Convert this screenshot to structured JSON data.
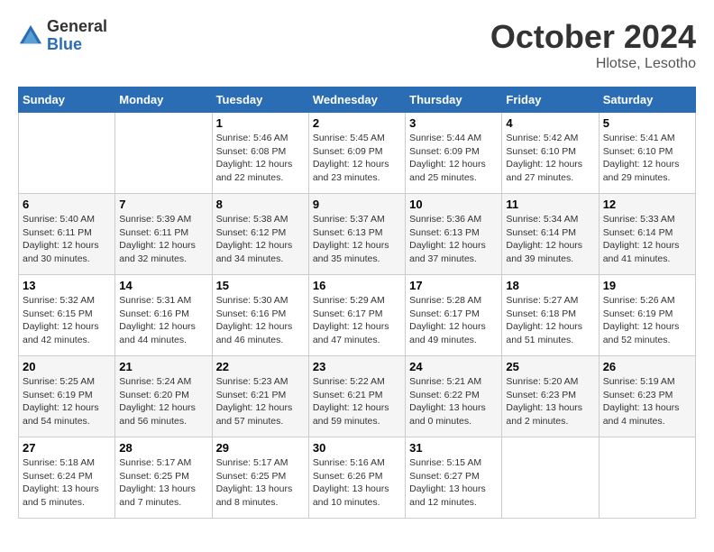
{
  "logo": {
    "general": "General",
    "blue": "Blue"
  },
  "title": "October 2024",
  "location": "Hlotse, Lesotho",
  "days_header": [
    "Sunday",
    "Monday",
    "Tuesday",
    "Wednesday",
    "Thursday",
    "Friday",
    "Saturday"
  ],
  "weeks": [
    [
      {
        "day": "",
        "sunrise": "",
        "sunset": "",
        "daylight": ""
      },
      {
        "day": "",
        "sunrise": "",
        "sunset": "",
        "daylight": ""
      },
      {
        "day": "1",
        "sunrise": "Sunrise: 5:46 AM",
        "sunset": "Sunset: 6:08 PM",
        "daylight": "Daylight: 12 hours and 22 minutes."
      },
      {
        "day": "2",
        "sunrise": "Sunrise: 5:45 AM",
        "sunset": "Sunset: 6:09 PM",
        "daylight": "Daylight: 12 hours and 23 minutes."
      },
      {
        "day": "3",
        "sunrise": "Sunrise: 5:44 AM",
        "sunset": "Sunset: 6:09 PM",
        "daylight": "Daylight: 12 hours and 25 minutes."
      },
      {
        "day": "4",
        "sunrise": "Sunrise: 5:42 AM",
        "sunset": "Sunset: 6:10 PM",
        "daylight": "Daylight: 12 hours and 27 minutes."
      },
      {
        "day": "5",
        "sunrise": "Sunrise: 5:41 AM",
        "sunset": "Sunset: 6:10 PM",
        "daylight": "Daylight: 12 hours and 29 minutes."
      }
    ],
    [
      {
        "day": "6",
        "sunrise": "Sunrise: 5:40 AM",
        "sunset": "Sunset: 6:11 PM",
        "daylight": "Daylight: 12 hours and 30 minutes."
      },
      {
        "day": "7",
        "sunrise": "Sunrise: 5:39 AM",
        "sunset": "Sunset: 6:11 PM",
        "daylight": "Daylight: 12 hours and 32 minutes."
      },
      {
        "day": "8",
        "sunrise": "Sunrise: 5:38 AM",
        "sunset": "Sunset: 6:12 PM",
        "daylight": "Daylight: 12 hours and 34 minutes."
      },
      {
        "day": "9",
        "sunrise": "Sunrise: 5:37 AM",
        "sunset": "Sunset: 6:13 PM",
        "daylight": "Daylight: 12 hours and 35 minutes."
      },
      {
        "day": "10",
        "sunrise": "Sunrise: 5:36 AM",
        "sunset": "Sunset: 6:13 PM",
        "daylight": "Daylight: 12 hours and 37 minutes."
      },
      {
        "day": "11",
        "sunrise": "Sunrise: 5:34 AM",
        "sunset": "Sunset: 6:14 PM",
        "daylight": "Daylight: 12 hours and 39 minutes."
      },
      {
        "day": "12",
        "sunrise": "Sunrise: 5:33 AM",
        "sunset": "Sunset: 6:14 PM",
        "daylight": "Daylight: 12 hours and 41 minutes."
      }
    ],
    [
      {
        "day": "13",
        "sunrise": "Sunrise: 5:32 AM",
        "sunset": "Sunset: 6:15 PM",
        "daylight": "Daylight: 12 hours and 42 minutes."
      },
      {
        "day": "14",
        "sunrise": "Sunrise: 5:31 AM",
        "sunset": "Sunset: 6:16 PM",
        "daylight": "Daylight: 12 hours and 44 minutes."
      },
      {
        "day": "15",
        "sunrise": "Sunrise: 5:30 AM",
        "sunset": "Sunset: 6:16 PM",
        "daylight": "Daylight: 12 hours and 46 minutes."
      },
      {
        "day": "16",
        "sunrise": "Sunrise: 5:29 AM",
        "sunset": "Sunset: 6:17 PM",
        "daylight": "Daylight: 12 hours and 47 minutes."
      },
      {
        "day": "17",
        "sunrise": "Sunrise: 5:28 AM",
        "sunset": "Sunset: 6:17 PM",
        "daylight": "Daylight: 12 hours and 49 minutes."
      },
      {
        "day": "18",
        "sunrise": "Sunrise: 5:27 AM",
        "sunset": "Sunset: 6:18 PM",
        "daylight": "Daylight: 12 hours and 51 minutes."
      },
      {
        "day": "19",
        "sunrise": "Sunrise: 5:26 AM",
        "sunset": "Sunset: 6:19 PM",
        "daylight": "Daylight: 12 hours and 52 minutes."
      }
    ],
    [
      {
        "day": "20",
        "sunrise": "Sunrise: 5:25 AM",
        "sunset": "Sunset: 6:19 PM",
        "daylight": "Daylight: 12 hours and 54 minutes."
      },
      {
        "day": "21",
        "sunrise": "Sunrise: 5:24 AM",
        "sunset": "Sunset: 6:20 PM",
        "daylight": "Daylight: 12 hours and 56 minutes."
      },
      {
        "day": "22",
        "sunrise": "Sunrise: 5:23 AM",
        "sunset": "Sunset: 6:21 PM",
        "daylight": "Daylight: 12 hours and 57 minutes."
      },
      {
        "day": "23",
        "sunrise": "Sunrise: 5:22 AM",
        "sunset": "Sunset: 6:21 PM",
        "daylight": "Daylight: 12 hours and 59 minutes."
      },
      {
        "day": "24",
        "sunrise": "Sunrise: 5:21 AM",
        "sunset": "Sunset: 6:22 PM",
        "daylight": "Daylight: 13 hours and 0 minutes."
      },
      {
        "day": "25",
        "sunrise": "Sunrise: 5:20 AM",
        "sunset": "Sunset: 6:23 PM",
        "daylight": "Daylight: 13 hours and 2 minutes."
      },
      {
        "day": "26",
        "sunrise": "Sunrise: 5:19 AM",
        "sunset": "Sunset: 6:23 PM",
        "daylight": "Daylight: 13 hours and 4 minutes."
      }
    ],
    [
      {
        "day": "27",
        "sunrise": "Sunrise: 5:18 AM",
        "sunset": "Sunset: 6:24 PM",
        "daylight": "Daylight: 13 hours and 5 minutes."
      },
      {
        "day": "28",
        "sunrise": "Sunrise: 5:17 AM",
        "sunset": "Sunset: 6:25 PM",
        "daylight": "Daylight: 13 hours and 7 minutes."
      },
      {
        "day": "29",
        "sunrise": "Sunrise: 5:17 AM",
        "sunset": "Sunset: 6:25 PM",
        "daylight": "Daylight: 13 hours and 8 minutes."
      },
      {
        "day": "30",
        "sunrise": "Sunrise: 5:16 AM",
        "sunset": "Sunset: 6:26 PM",
        "daylight": "Daylight: 13 hours and 10 minutes."
      },
      {
        "day": "31",
        "sunrise": "Sunrise: 5:15 AM",
        "sunset": "Sunset: 6:27 PM",
        "daylight": "Daylight: 13 hours and 12 minutes."
      },
      {
        "day": "",
        "sunrise": "",
        "sunset": "",
        "daylight": ""
      },
      {
        "day": "",
        "sunrise": "",
        "sunset": "",
        "daylight": ""
      }
    ]
  ]
}
